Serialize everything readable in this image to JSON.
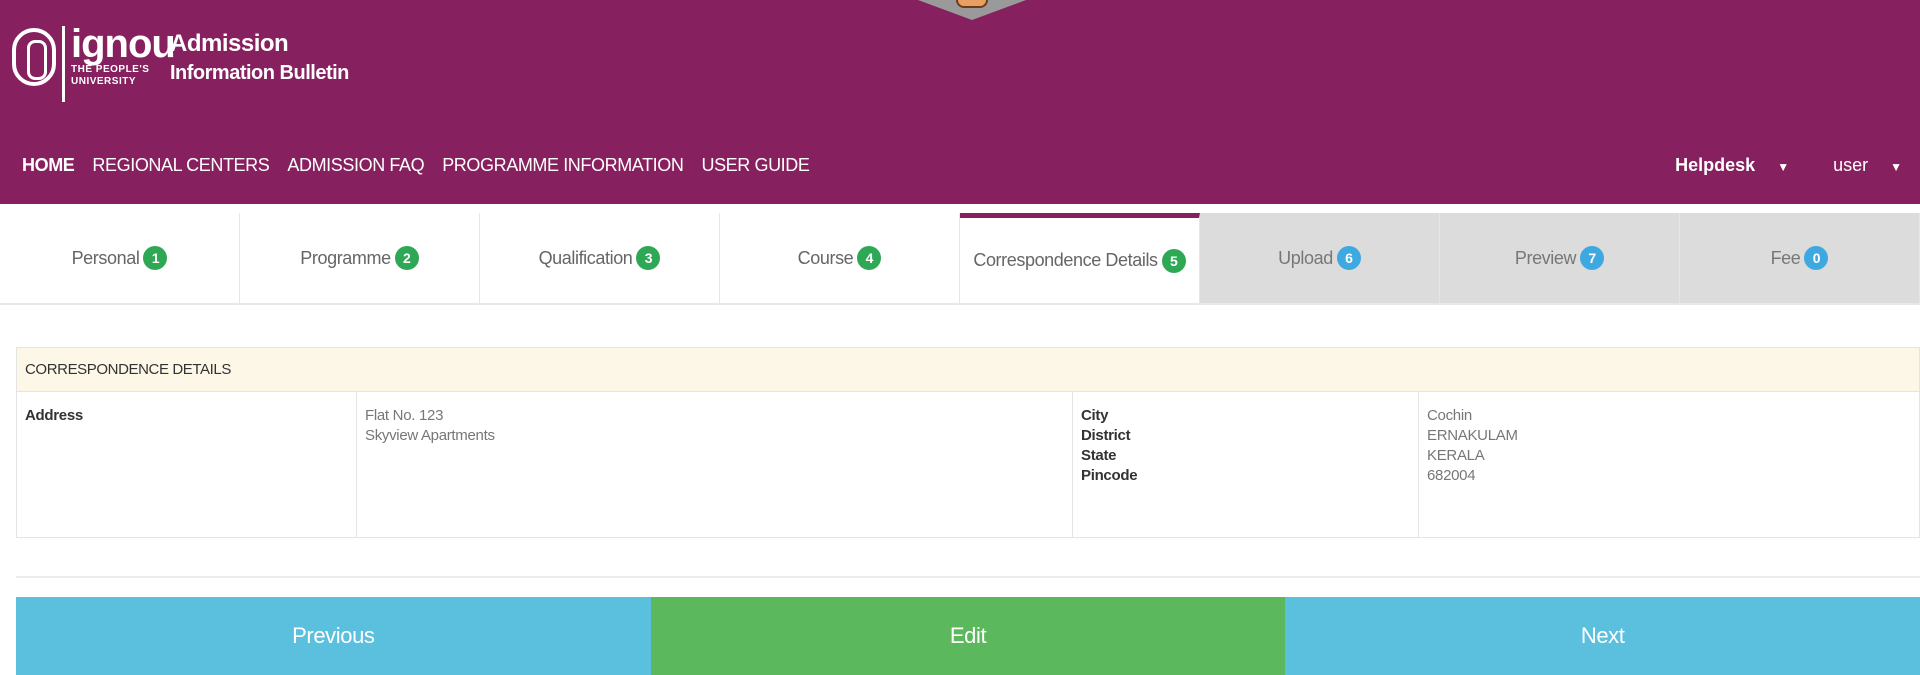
{
  "header": {
    "logo_word": "ignou",
    "logo_sub_1": "THE PEOPLE'S",
    "logo_sub_2": "UNIVERSITY",
    "title_1": "Admission",
    "title_2": "Information Bulletin",
    "nav": [
      "HOME",
      "REGIONAL CENTERS",
      "ADMISSION FAQ",
      "PROGRAMME INFORMATION",
      "USER GUIDE"
    ],
    "helpdesk_label": "Helpdesk",
    "user_label": "user"
  },
  "tabs": [
    {
      "label": "Personal",
      "num": "1",
      "state": "done"
    },
    {
      "label": "Programme",
      "num": "2",
      "state": "done"
    },
    {
      "label": "Qualification",
      "num": "3",
      "state": "done"
    },
    {
      "label": "Course",
      "num": "4",
      "state": "done"
    },
    {
      "label": "Correspondence Details",
      "num": "5",
      "state": "active"
    },
    {
      "label": "Upload",
      "num": "6",
      "state": "disabled"
    },
    {
      "label": "Preview",
      "num": "7",
      "state": "disabled"
    },
    {
      "label": "Fee",
      "num": "0",
      "state": "disabled"
    }
  ],
  "details": {
    "heading": "CORRESPONDENCE DETAILS",
    "address_label": "Address",
    "address_line_1": "Flat No. 123",
    "address_line_2": "Skyview Apartments",
    "labels": [
      "City",
      "District",
      "State",
      "Pincode"
    ],
    "values": [
      "Cochin",
      "ERNAKULAM",
      "KERALA",
      "682004"
    ]
  },
  "buttons": {
    "previous": "Previous",
    "edit": "Edit",
    "next": "Next"
  },
  "colors": {
    "header_bg": "#86205e",
    "step_done": "#2fa856",
    "step_pending": "#3ea9e0",
    "btn_info": "#5bc0de",
    "btn_success": "#5cb85c"
  }
}
